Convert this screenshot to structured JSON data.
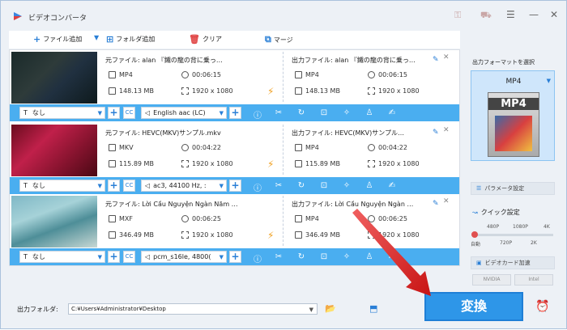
{
  "app": {
    "title": "ビデオコンバータ"
  },
  "toolbar": {
    "add_file": "ファイル追加",
    "add_folder": "フォルダ追加",
    "clear": "クリア",
    "merge": "マージ"
  },
  "items": [
    {
      "src_name": "元ファイル: alan 『鐵の龍の背に乗っ…",
      "src_format": "MP4",
      "src_duration": "00:06:15",
      "src_size": "148.13 MB",
      "src_res": "1920 x 1080",
      "dst_name": "出力ファイル: alan 『鐵の龍の背に乗っ…",
      "dst_format": "MP4",
      "dst_duration": "00:06:15",
      "dst_size": "148.13 MB",
      "dst_res": "1920 x 1080",
      "subtitle": "なし",
      "audio": "English aac (LC)"
    },
    {
      "src_name": "元ファイル: HEVC(MKV)サンプル.mkv",
      "src_format": "MKV",
      "src_duration": "00:04:22",
      "src_size": "115.89 MB",
      "src_res": "1920 x 1080",
      "dst_name": "出力ファイル: HEVC(MKV)サンプル…",
      "dst_format": "MP4",
      "dst_duration": "00:04:22",
      "dst_size": "115.89 MB",
      "dst_res": "1920 x 1080",
      "subtitle": "なし",
      "audio": "ac3, 44100 Hz, :"
    },
    {
      "src_name": "元ファイル: Lời Cầu Nguyện Ngàn Năm …",
      "src_format": "MXF",
      "src_duration": "00:06:25",
      "src_size": "346.49 MB",
      "src_res": "1920 x 1080",
      "dst_name": "出力ファイル: Lời Cầu Nguyện Ngàn …",
      "dst_format": "MP4",
      "dst_duration": "00:06:25",
      "dst_size": "346.49 MB",
      "dst_res": "1920 x 1080",
      "subtitle": "なし",
      "audio": "pcm_s16le, 4800("
    }
  ],
  "side": {
    "title": "出力フォーマットを選択",
    "format": "MP4",
    "format_icon_text": "MP4",
    "param": "パラメータ設定",
    "quick": "クイック設定",
    "top_labels": [
      "480P",
      "1080P",
      "4K"
    ],
    "bottom_labels": [
      "自動",
      "720P",
      "2K"
    ],
    "quality_level": 0.0,
    "gpu": "ビデオカード加速",
    "gpu_chips": [
      "NVIDIA",
      "Intel"
    ]
  },
  "bottom": {
    "output_label": "出力フォルダ:",
    "path": "C:¥Users¥Administrator¥Desktop",
    "convert": "変換"
  },
  "colors": {
    "accent": "#2e96e8",
    "bar": "#4aaef0",
    "arrow": "#e02020"
  }
}
